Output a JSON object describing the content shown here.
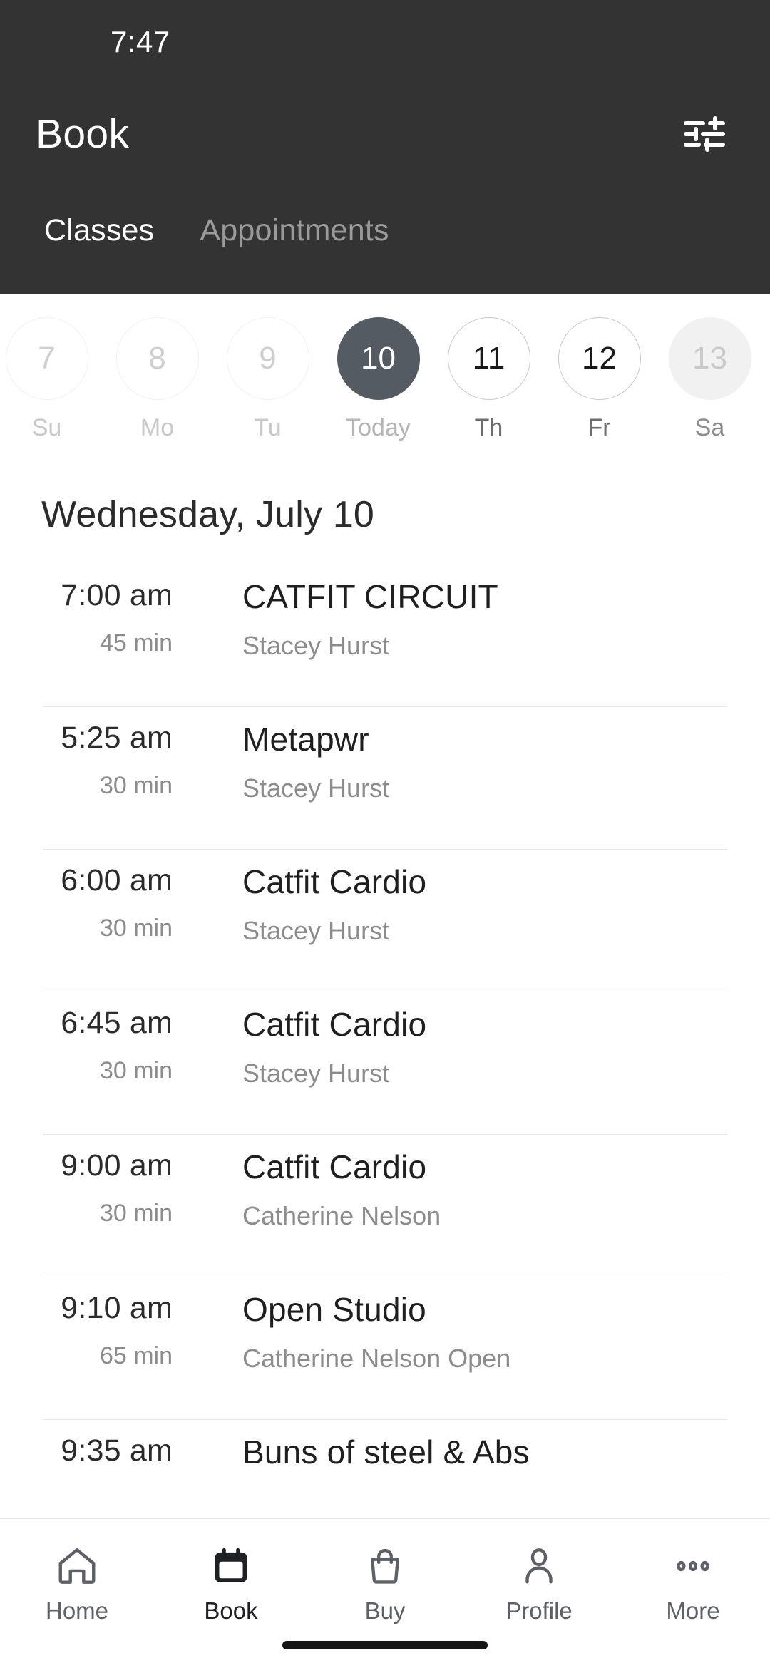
{
  "status_bar": {
    "time": "7:47"
  },
  "header": {
    "title": "Book",
    "filter_icon": "sliders-filter-icon",
    "colors": {
      "background": "#333333",
      "title": "#ffffff",
      "tab_inactive": "#9a9a9a"
    },
    "tabs": [
      {
        "label": "Classes",
        "state": "active"
      },
      {
        "label": "Appointments",
        "state": "inactive"
      }
    ]
  },
  "date_strip": {
    "days": [
      {
        "number": "7",
        "weekday": "Su",
        "state": "disabled"
      },
      {
        "number": "8",
        "weekday": "Mo",
        "state": "disabled"
      },
      {
        "number": "9",
        "weekday": "Tu",
        "state": "disabled"
      },
      {
        "number": "10",
        "weekday": "Today",
        "state": "today"
      },
      {
        "number": "11",
        "weekday": "Th",
        "state": "available"
      },
      {
        "number": "12",
        "weekday": "Fr",
        "state": "available"
      },
      {
        "number": "13",
        "weekday": "Sa",
        "state": "edge"
      }
    ],
    "selected_color": "#555b63"
  },
  "day_heading": "Wednesday, July 10",
  "classes": [
    {
      "time": "7:00 am",
      "duration": "45 min",
      "name": "CATFIT CIRCUIT",
      "instructor": "Stacey Hurst"
    },
    {
      "time": "5:25 am",
      "duration": "30 min",
      "name": "Metapwr",
      "instructor": "Stacey Hurst"
    },
    {
      "time": "6:00 am",
      "duration": "30 min",
      "name": "Catfit Cardio",
      "instructor": "Stacey Hurst"
    },
    {
      "time": "6:45 am",
      "duration": "30 min",
      "name": "Catfit Cardio",
      "instructor": "Stacey Hurst"
    },
    {
      "time": "9:00 am",
      "duration": "30 min",
      "name": "Catfit Cardio",
      "instructor": "Catherine Nelson"
    },
    {
      "time": "9:10 am",
      "duration": "65 min",
      "name": "Open Studio",
      "instructor": "Catherine Nelson Open"
    },
    {
      "time": "9:35 am",
      "duration": "",
      "name": "Buns of steel & Abs",
      "instructor": ""
    }
  ],
  "bottom_nav": {
    "items": [
      {
        "label": "Home",
        "icon": "home-icon",
        "state": "inactive"
      },
      {
        "label": "Book",
        "icon": "calendar-icon",
        "state": "active"
      },
      {
        "label": "Buy",
        "icon": "bag-icon",
        "state": "inactive"
      },
      {
        "label": "Profile",
        "icon": "person-icon",
        "state": "inactive"
      },
      {
        "label": "More",
        "icon": "ellipsis-icon",
        "state": "inactive"
      }
    ]
  }
}
